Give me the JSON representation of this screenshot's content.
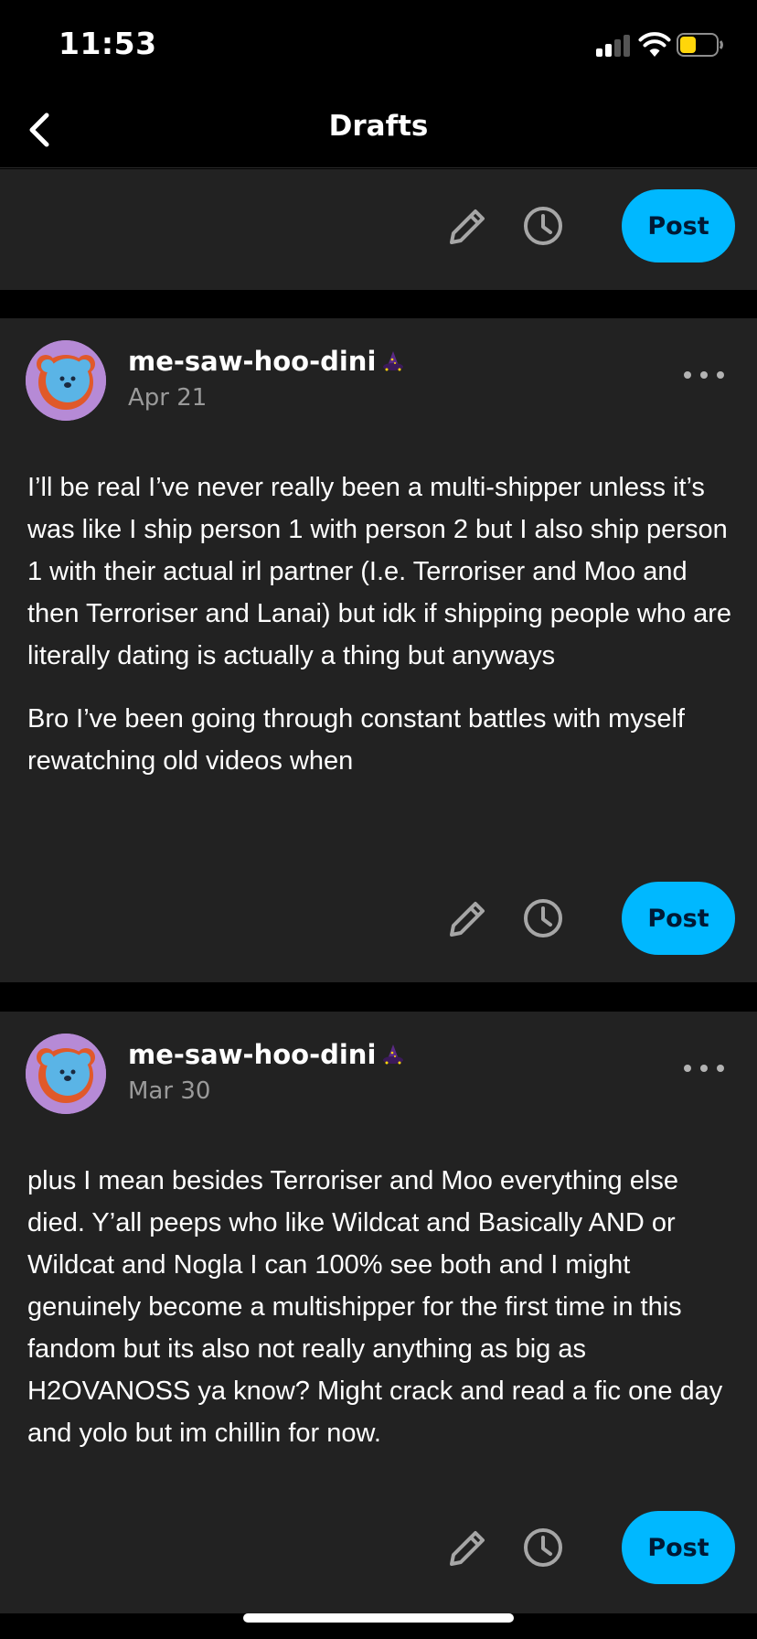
{
  "status_bar": {
    "time": "11:53",
    "battery_color": "#ffd60a"
  },
  "nav": {
    "title": "Drafts",
    "back_icon": "chevron-left-icon"
  },
  "colors": {
    "accent": "#00b8ff",
    "card_bg": "#222222",
    "page_bg": "#000000",
    "date_gray": "#9a9a9a"
  },
  "drafts": [
    {
      "post_label": "Post"
    },
    {
      "blog_name": "me-saw-hoo-dini",
      "date": "Apr 21",
      "paragraphs": [
        "I’ll be real I’ve never really been a multi-shipper unless it’s was like I ship person 1 with person 2 but I also ship person 1 with their actual irl partner (I.e. Terroriser and Moo and then Terroriser and Lanai) but idk if shipping people who are literally dating is actually a thing but anyways",
        "Bro I’ve been going through constant battles with myself rewatching old videos when"
      ],
      "post_label": "Post"
    },
    {
      "blog_name": "me-saw-hoo-dini",
      "date": "Mar 30",
      "paragraphs": [
        "plus I mean besides Terroriser and Moo everything else died. Y’all peeps who like Wildcat and Basically AND or Wildcat and Nogla I can 100% see both and I might genuinely become a multishipper for the first time in this fandom but its also not really anything as big as H2OVANOSS ya know? Might crack and read a fic one day and yolo but im chillin for now."
      ],
      "post_label": "Post"
    }
  ]
}
